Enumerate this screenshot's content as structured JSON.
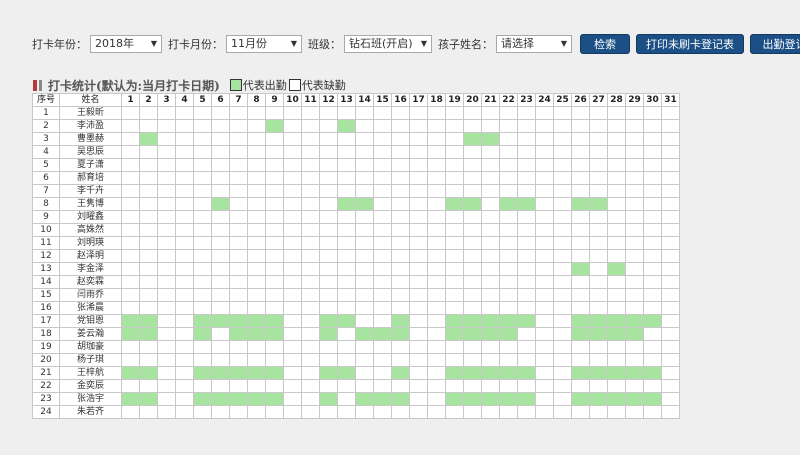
{
  "filters": {
    "year_label": "打卡年份：",
    "year_value": "2018年",
    "month_label": "打卡月份：",
    "month_value": "11月份",
    "class_label": "班级：",
    "class_value": "钻石班(开启)",
    "child_label": "孩子姓名：",
    "child_value": "请选择"
  },
  "buttons": {
    "search": "检索",
    "print_unpunched": "打印未刷卡登记表",
    "attendance_register": "出勤登记表"
  },
  "section": {
    "title": "打卡统计(默认为:当月打卡日期)",
    "legend_present": "代表出勤",
    "legend_absent": "代表缺勤"
  },
  "colors": {
    "present": "#a7e4a0",
    "absent": "#ffffff",
    "button": "#1b4f85",
    "marker": "#b53a3a"
  },
  "table": {
    "col_index": "序号",
    "col_name": "姓名",
    "days": [
      "1",
      "2",
      "3",
      "4",
      "5",
      "6",
      "7",
      "8",
      "9",
      "10",
      "11",
      "12",
      "13",
      "14",
      "15",
      "16",
      "17",
      "18",
      "19",
      "20",
      "21",
      "22",
      "23",
      "24",
      "25",
      "26",
      "27",
      "28",
      "29",
      "30",
      "31"
    ],
    "rows": [
      {
        "no": "1",
        "name": "王毅昕",
        "present": []
      },
      {
        "no": "2",
        "name": "李沛盈",
        "present": [
          9,
          13
        ]
      },
      {
        "no": "3",
        "name": "曹墨赫",
        "present": [
          2,
          20,
          21
        ]
      },
      {
        "no": "4",
        "name": "吴思辰",
        "present": []
      },
      {
        "no": "5",
        "name": "夏子潇",
        "present": []
      },
      {
        "no": "6",
        "name": "郝育培",
        "present": []
      },
      {
        "no": "7",
        "name": "李千卉",
        "present": []
      },
      {
        "no": "8",
        "name": "王隽博",
        "present": [
          6,
          13,
          14,
          19,
          20,
          22,
          23,
          26,
          27
        ]
      },
      {
        "no": "9",
        "name": "刘曜鑫",
        "present": []
      },
      {
        "no": "10",
        "name": "高姝然",
        "present": []
      },
      {
        "no": "11",
        "name": "刘明瑛",
        "present": []
      },
      {
        "no": "12",
        "name": "赵泽明",
        "present": []
      },
      {
        "no": "13",
        "name": "李金泽",
        "present": [
          26,
          28
        ]
      },
      {
        "no": "14",
        "name": "赵奕霖",
        "present": []
      },
      {
        "no": "15",
        "name": "闫雨乔",
        "present": []
      },
      {
        "no": "16",
        "name": "张浠晨",
        "present": []
      },
      {
        "no": "17",
        "name": "党钼恩",
        "present": [
          1,
          2,
          5,
          6,
          7,
          8,
          9,
          12,
          13,
          16,
          19,
          20,
          21,
          22,
          23,
          26,
          27,
          28,
          29,
          30
        ]
      },
      {
        "no": "18",
        "name": "姜云瀚",
        "present": [
          1,
          2,
          5,
          7,
          8,
          9,
          12,
          14,
          15,
          16,
          19,
          20,
          21,
          22,
          26,
          27,
          28,
          29
        ]
      },
      {
        "no": "19",
        "name": "胡珈豪",
        "present": []
      },
      {
        "no": "20",
        "name": "杨子琪",
        "present": []
      },
      {
        "no": "21",
        "name": "王梓航",
        "present": [
          1,
          2,
          5,
          6,
          7,
          8,
          9,
          12,
          13,
          16,
          19,
          20,
          21,
          22,
          23,
          26,
          27,
          28,
          29,
          30
        ]
      },
      {
        "no": "22",
        "name": "金奕辰",
        "present": []
      },
      {
        "no": "23",
        "name": "张浩宇",
        "present": [
          1,
          2,
          5,
          6,
          7,
          8,
          9,
          12,
          14,
          15,
          16,
          19,
          20,
          21,
          22,
          23,
          26,
          27,
          28,
          29,
          30
        ]
      },
      {
        "no": "24",
        "name": "朱若齐",
        "present": []
      }
    ]
  }
}
